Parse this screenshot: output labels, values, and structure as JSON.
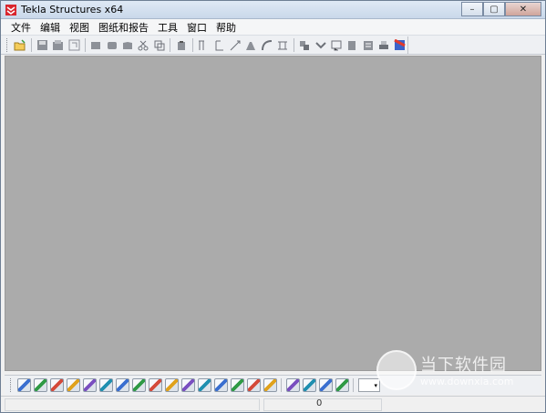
{
  "window": {
    "title": "Tekla Structures x64",
    "controls": {
      "minimize": "–",
      "maximize": "▢",
      "close": "✕"
    }
  },
  "menu": {
    "items": [
      "文件",
      "编辑",
      "视图",
      "图纸和报告",
      "工具",
      "窗口",
      "帮助"
    ]
  },
  "toolbar": {
    "groups": [
      [
        "open-folder-icon"
      ],
      [
        "save-icon",
        "save-as-icon",
        "properties-icon"
      ],
      [
        "select-all-icon",
        "select-part-icon",
        "select-assembly-icon",
        "cut-icon",
        "copy-icon"
      ],
      [
        "clipboard-icon"
      ],
      [
        "column-icon",
        "beam-icon",
        "brace-icon",
        "plate-icon",
        "bend-icon",
        "panel-icon"
      ],
      [
        "group-icon",
        "component-icon",
        "drawing-icon",
        "report-icon",
        "sheet-icon",
        "print-icon",
        "render-icon"
      ]
    ]
  },
  "bottom_toolbar": {
    "icons": [
      "snap-ref-icon",
      "snap-geom-icon",
      "snap-center-icon",
      "snap-mid-icon",
      "snap-end-icon",
      "snap-intersect-icon",
      "snap-perp-icon",
      "snap-line-icon",
      "snap-near-icon",
      "snap-any-icon",
      "snap-edge-icon",
      "snap-plane-icon",
      "snap-grid-icon",
      "snap-point-icon",
      "snap-extend-icon",
      "snap-ortho-icon",
      "view-plane-icon",
      "view-3d-icon",
      "view-work-icon",
      "view-pick-icon"
    ],
    "combo_symbol": "▾"
  },
  "statusbar": {
    "value": "0"
  },
  "watermark": {
    "text": "当下软件园",
    "url": "www.downxia.com"
  },
  "colors": {
    "workarea": "#ababab",
    "titlebar": "#c9d8ea",
    "chrome": "#f0f0f0"
  }
}
